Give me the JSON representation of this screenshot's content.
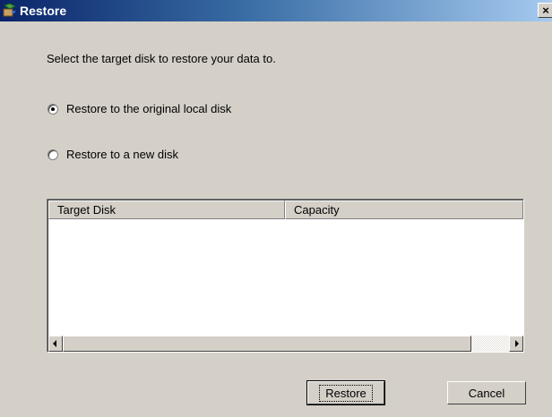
{
  "window": {
    "title": "Restore",
    "close_glyph": "×",
    "icon": "restore-app-icon"
  },
  "instruction": "Select the target disk to restore your data to.",
  "options": [
    {
      "label": "Restore to the original local disk",
      "selected": true
    },
    {
      "label": "Restore to a new disk",
      "selected": false
    }
  ],
  "table": {
    "columns": [
      "Target Disk",
      "Capacity"
    ],
    "rows": []
  },
  "scrollbar": {
    "left_icon": "scroll-left-icon",
    "right_icon": "scroll-right-icon"
  },
  "buttons": {
    "restore": "Restore",
    "cancel": "Cancel"
  },
  "colors": {
    "title_start": "#0a246a",
    "title_end": "#a6caf0",
    "face": "#d4d0c8"
  }
}
